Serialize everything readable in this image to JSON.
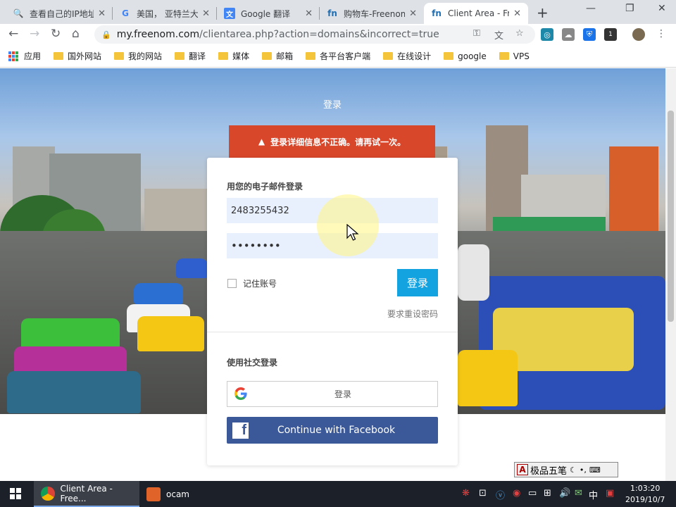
{
  "browser": {
    "tabs": [
      {
        "title": "查看自己的IP地址",
        "icon": "search-icon"
      },
      {
        "title": "美国， 亚特兰大",
        "icon": "google-icon"
      },
      {
        "title": "Google 翻译",
        "icon": "translate-icon"
      },
      {
        "title": "购物车-Freenom",
        "icon": "freenom-icon"
      },
      {
        "title": "Client Area - Free",
        "icon": "freenom-icon",
        "active": true
      }
    ],
    "url_host": "my.freenom.com",
    "url_path": "/clientarea.php?action=domains&incorrect=true",
    "bookmarks": [
      "应用",
      "国外网站",
      "我的网站",
      "翻译",
      "媒体",
      "邮箱",
      "各平台客户端",
      "在线设计",
      "google",
      "VPS"
    ],
    "extension_badge": "1"
  },
  "page": {
    "top_login_label": "登录",
    "alert": "登录详细信息不正确。请再试一次。",
    "email_section_title": "用您的电子邮件登录",
    "email_value": "2483255432",
    "password_value": "••••••••",
    "remember_label": "记住账号",
    "login_button": "登录",
    "forgot_link": "要求重设密码",
    "social_section_title": "使用社交登录",
    "google_button": "登录",
    "facebook_button": "Continue with Facebook"
  },
  "ime": {
    "label": "极品五笔"
  },
  "taskbar": {
    "items": [
      {
        "label": "Client Area - Free...",
        "active": true
      },
      {
        "label": "ocam",
        "active": false
      }
    ],
    "tray_lang": "中",
    "time": "1:03:20",
    "date": "2019/10/7"
  },
  "colors": {
    "alert": "#d9472b",
    "login_button": "#13a3e1",
    "facebook": "#3b5998",
    "field_bg": "#e8f0fe"
  }
}
